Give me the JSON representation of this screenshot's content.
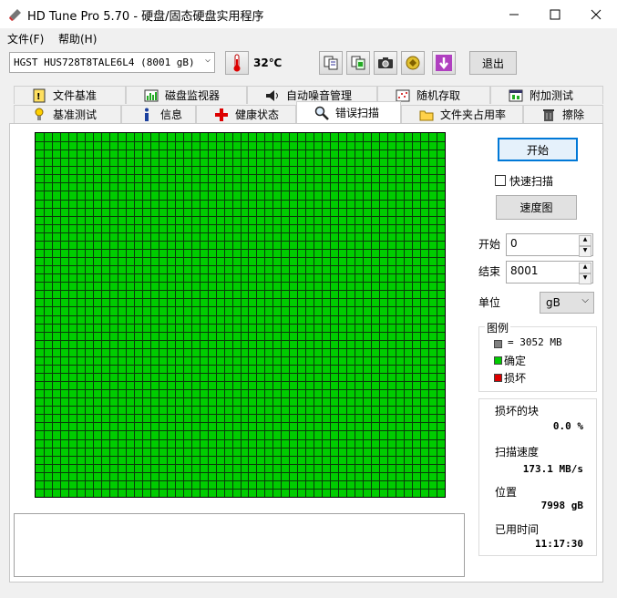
{
  "window": {
    "title": "HD Tune Pro 5.70 - 硬盘/固态硬盘实用程序"
  },
  "menu": {
    "file": "文件(F)",
    "help": "帮助(H)"
  },
  "toolbar": {
    "drive": "HGST HUS728T8TALE6L4 (8001 gB)",
    "temperature": "32℃",
    "exit_label": "退出"
  },
  "tabs_top": [
    {
      "label": "文件基准",
      "icon": "file-benchmark-icon"
    },
    {
      "label": "磁盘监视器",
      "icon": "disk-monitor-icon"
    },
    {
      "label": "自动噪音管理",
      "icon": "speaker-icon"
    },
    {
      "label": "随机存取",
      "icon": "random-access-icon"
    },
    {
      "label": "附加测试",
      "icon": "extra-tests-icon"
    }
  ],
  "tabs_bottom": [
    {
      "label": "基准测试",
      "icon": "benchmark-icon"
    },
    {
      "label": "信息",
      "icon": "info-icon"
    },
    {
      "label": "健康状态",
      "icon": "health-icon"
    },
    {
      "label": "错误扫描",
      "icon": "magnifier-icon"
    },
    {
      "label": "文件夹占用率",
      "icon": "folder-icon"
    },
    {
      "label": "擦除",
      "icon": "trash-icon"
    }
  ],
  "scan": {
    "start_button": "开始",
    "quick_scan": "快速扫描",
    "quick_scan_checked": false,
    "speed_map_button": "速度图",
    "start_label": "开始",
    "start_value": "0",
    "end_label": "结束",
    "end_value": "8001",
    "unit_label": "单位",
    "unit_value": "gB",
    "legend_title": "图例",
    "legend_block": "= 3052 MB",
    "legend_ok": "确定",
    "legend_bad": "损坏",
    "damaged_label": "损坏的块",
    "damaged_value": "0.0 %",
    "speed_label": "扫描速度",
    "speed_value": "173.1 MB/s",
    "position_label": "位置",
    "position_value": "7998 gB",
    "elapsed_label": "已用时间",
    "elapsed_value": "11:17:30"
  },
  "grid": {
    "columns": 50,
    "rows": 44,
    "ok_color": "#00cc00",
    "bad_color": "#dd0000",
    "damaged_blocks": 0
  },
  "colors": {
    "ok": "#00cc00",
    "bad": "#dd0000",
    "block": "#808080"
  }
}
